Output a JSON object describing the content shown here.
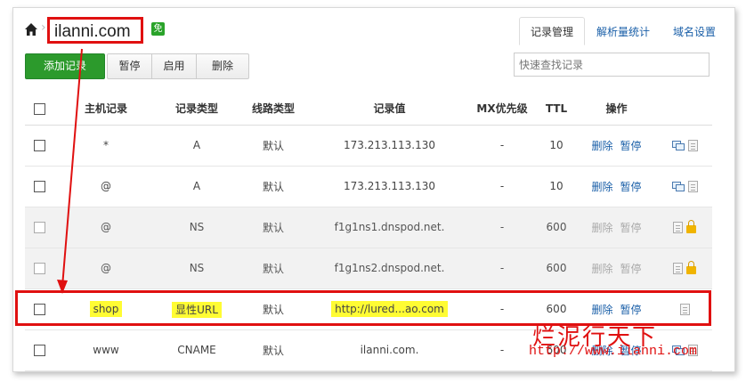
{
  "header": {
    "domain": "ilanni.com",
    "free_badge": "免",
    "tabs": [
      {
        "label": "记录管理",
        "active": true
      },
      {
        "label": "解析量统计",
        "active": false
      },
      {
        "label": "域名设置",
        "active": false
      }
    ]
  },
  "toolbar": {
    "add_label": "添加记录",
    "pause_label": "暂停",
    "enable_label": "启用",
    "delete_label": "删除",
    "search_placeholder": "快速查找记录"
  },
  "table": {
    "columns": [
      "主机记录",
      "记录类型",
      "线路类型",
      "记录值",
      "MX优先级",
      "TTL",
      "操作"
    ],
    "rows": [
      {
        "host": "*",
        "type": "A",
        "line": "默认",
        "value": "173.213.113.130",
        "mx": "-",
        "ttl": "10",
        "op_delete": "删除",
        "op_pause": "暂停",
        "disabled": false
      },
      {
        "host": "@",
        "type": "A",
        "line": "默认",
        "value": "173.213.113.130",
        "mx": "-",
        "ttl": "10",
        "op_delete": "删除",
        "op_pause": "暂停",
        "disabled": false
      },
      {
        "host": "@",
        "type": "NS",
        "line": "默认",
        "value": "f1g1ns1.dnspod.net.",
        "mx": "-",
        "ttl": "600",
        "op_delete": "删除",
        "op_pause": "暂停",
        "disabled": true
      },
      {
        "host": "@",
        "type": "NS",
        "line": "默认",
        "value": "f1g1ns2.dnspod.net.",
        "mx": "-",
        "ttl": "600",
        "op_delete": "删除",
        "op_pause": "暂停",
        "disabled": true
      },
      {
        "host": "shop",
        "type": "显性URL",
        "line": "默认",
        "value": "http://lured...ao.com",
        "mx": "-",
        "ttl": "600",
        "op_delete": "删除",
        "op_pause": "暂停",
        "disabled": false
      },
      {
        "host": "www",
        "type": "CNAME",
        "line": "默认",
        "value": "ilanni.com.",
        "mx": "-",
        "ttl": "600",
        "op_delete": "删除",
        "op_pause": "暂停",
        "disabled": false
      }
    ]
  },
  "watermark": {
    "text_cn": "烂泥行天下",
    "url": "http://www.ilanni.com"
  },
  "colors": {
    "accent_green": "#2c9a2c",
    "link_blue": "#1a5fa8",
    "annotation_red": "#e01010",
    "highlight_yellow": "#fffc33"
  }
}
